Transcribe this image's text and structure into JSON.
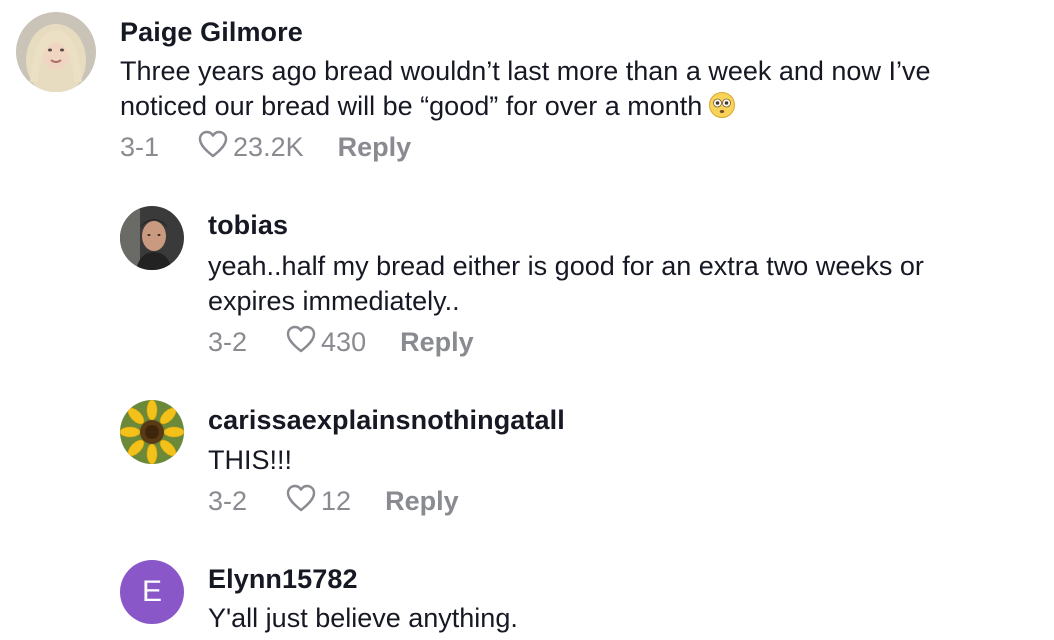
{
  "comments": [
    {
      "username": "Paige Gilmore",
      "line1": "Three years ago bread wouldn’t last more than a week and now I’ve",
      "line2": "noticed our bread will be “good” for over a month",
      "emoji": "flushed-face-emoji",
      "date": "3-1",
      "likes": "23.2K",
      "reply_label": "Reply"
    },
    {
      "username": "tobias",
      "line1": "yeah..half my bread either is good for an extra two weeks or",
      "line2": "expires immediately..",
      "date": "3-2",
      "likes": "430",
      "reply_label": "Reply"
    },
    {
      "username": "carissaexplainsnothingatall",
      "line1": "THIS!!!",
      "date": "3-2",
      "likes": "12",
      "reply_label": "Reply"
    },
    {
      "username": "Elynn15782",
      "avatar_initial": "E",
      "avatar_color": "#8a57c9",
      "line1": "Y'all just believe anything."
    }
  ],
  "icons": {
    "like": "heart-outline-icon"
  },
  "colors": {
    "secondary_text": "#8a8b91",
    "primary_text": "#161823"
  }
}
